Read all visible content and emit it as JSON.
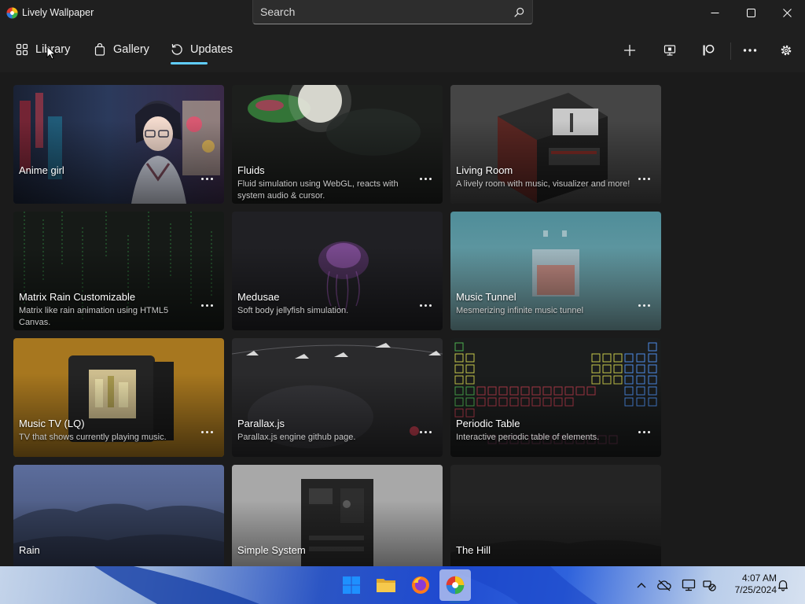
{
  "window": {
    "title": "Lively Wallpaper",
    "search_placeholder": "Search",
    "controls": [
      "minimize",
      "maximize",
      "close"
    ]
  },
  "nav": {
    "tabs": [
      {
        "label": "Library",
        "icon": "library-grid-icon"
      },
      {
        "label": "Gallery",
        "icon": "gallery-bag-icon"
      },
      {
        "label": "Updates",
        "icon": "updates-refresh-icon"
      }
    ],
    "selected_tab": "Updates",
    "toolbar_icons": [
      "add-icon",
      "screen-icon",
      "patreon-icon",
      "more-icon",
      "gear-icon"
    ]
  },
  "wallpapers": [
    {
      "title": "Anime girl",
      "description": ""
    },
    {
      "title": "Fluids",
      "description": "Fluid simulation using WebGL, reacts with system audio & cursor."
    },
    {
      "title": "Living Room",
      "description": "A lively room with music, visualizer and more!"
    },
    {
      "title": "Matrix Rain Customizable",
      "description": "Matrix like rain animation using HTML5 Canvas."
    },
    {
      "title": "Medusae",
      "description": "Soft body jellyfish simulation."
    },
    {
      "title": "Music Tunnel",
      "description": "Mesmerizing infinite music tunnel"
    },
    {
      "title": "Music TV (LQ)",
      "description": "TV that shows currently playing music."
    },
    {
      "title": "Parallax.js",
      "description": "Parallax.js engine github page."
    },
    {
      "title": "Periodic Table",
      "description": "Interactive periodic table of elements."
    },
    {
      "title": "Rain",
      "description": ""
    },
    {
      "title": "Simple System",
      "description": ""
    },
    {
      "title": "The Hill",
      "description": ""
    }
  ],
  "taskbar": {
    "apps": [
      "windows-start-icon",
      "file-explorer-icon",
      "firefox-icon",
      "lively-wallpaper-icon"
    ],
    "tray_icons": [
      "chevron-up-icon",
      "onedrive-icon",
      "display-icon",
      "network-icon",
      "bell-icon"
    ],
    "time": "4:07 AM",
    "date": "7/25/2024"
  },
  "colors": {
    "accent": "#60cdff",
    "window_background": "#1c1c1c",
    "card_background": "#2a2a2a"
  }
}
